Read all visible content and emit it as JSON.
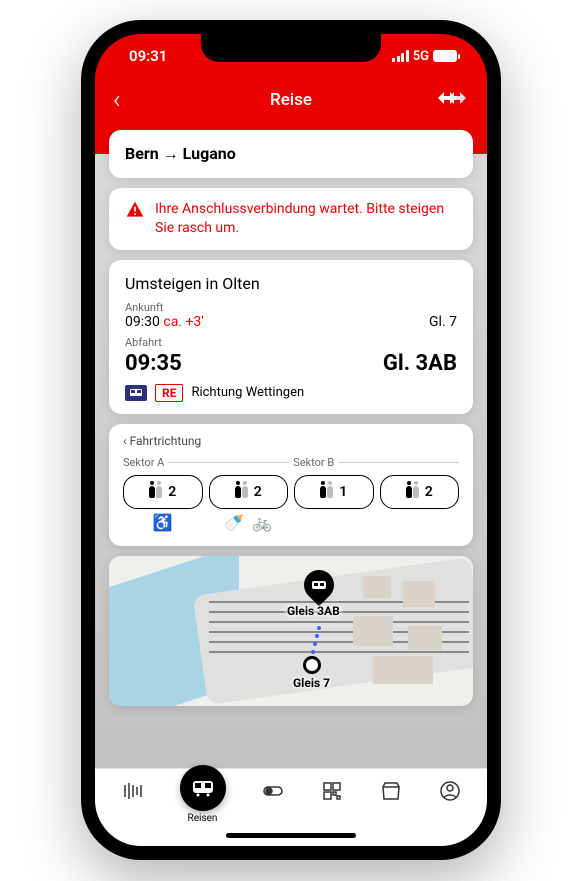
{
  "status": {
    "time": "09:31",
    "network": "5G"
  },
  "nav": {
    "title": "Reise"
  },
  "route": {
    "from": "Bern",
    "to": "Lugano"
  },
  "alert": {
    "text": "Ihre Anschlussverbindung wartet. Bitte steigen Sie rasch um."
  },
  "transfer": {
    "title": "Umsteigen in Olten",
    "arrival_label": "Ankunft",
    "arrival_time": "09:30",
    "arrival_delay": "ca. +3'",
    "arrival_track": "Gl. 7",
    "departure_label": "Abfahrt",
    "departure_time": "09:35",
    "departure_track": "Gl. 3AB",
    "train_type": "RE",
    "direction": "Richtung Wettingen"
  },
  "formation": {
    "direction_label": "Fahrtrichtung",
    "sectors": [
      "Sektor A",
      "Sektor B"
    ],
    "cars": [
      {
        "class": "2"
      },
      {
        "class": "2"
      },
      {
        "class": "1"
      },
      {
        "class": "2"
      }
    ]
  },
  "map": {
    "label_dest": "Gleis 3AB",
    "label_origin": "Gleis 7"
  },
  "tabs": {
    "active_label": "Reisen"
  }
}
